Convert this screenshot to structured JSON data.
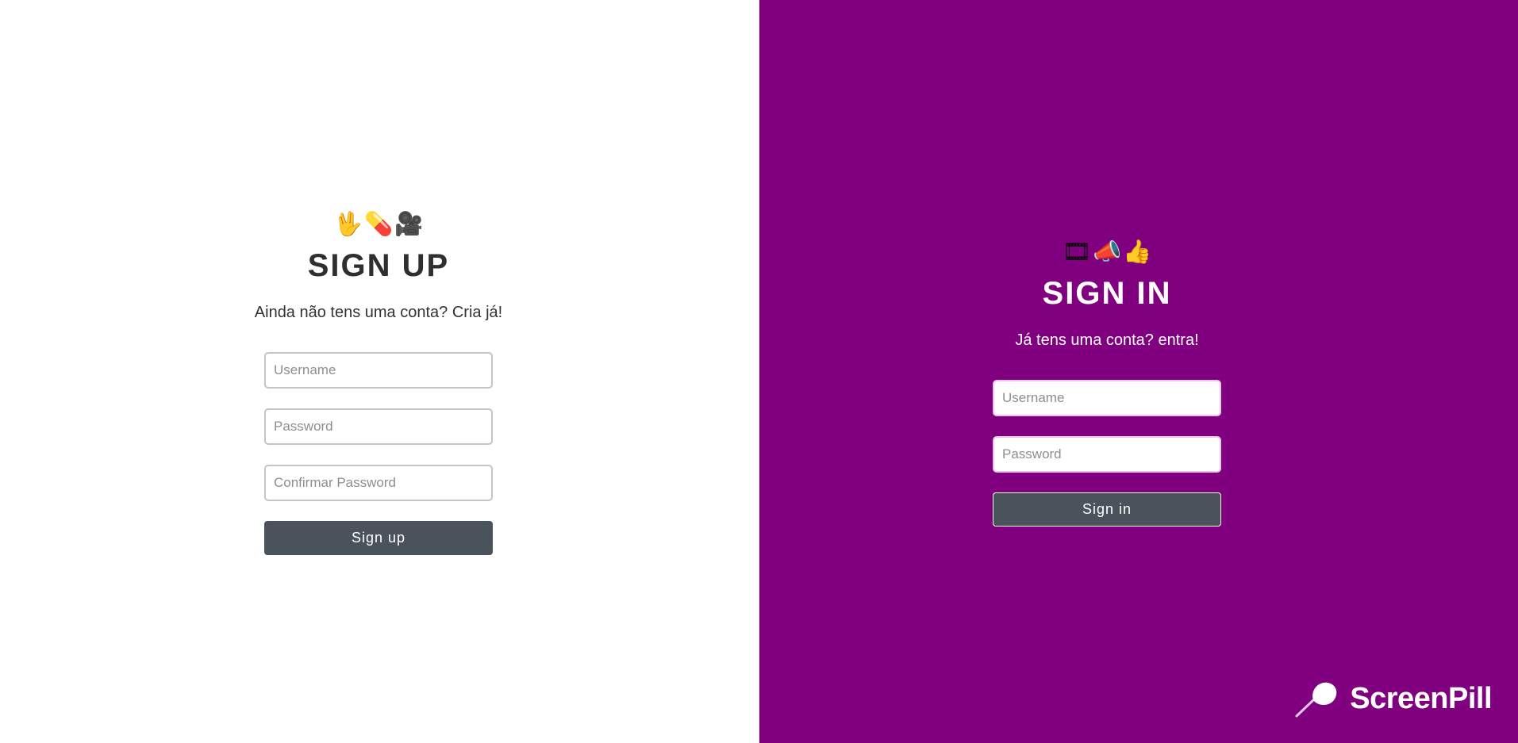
{
  "signup": {
    "emojis": [
      "🖖",
      "💊",
      "🎥"
    ],
    "title": "SIGN UP",
    "subtitle": "Ainda não tens uma conta? Cria já!",
    "username_placeholder": "Username",
    "password_placeholder": "Password",
    "confirm_password_placeholder": "Confirmar Password",
    "button_label": "Sign up"
  },
  "signin": {
    "emojis": [
      "🎞",
      "📣",
      "👍"
    ],
    "title": "SIGN IN",
    "subtitle": "Já tens uma conta? entra!",
    "username_placeholder": "Username",
    "password_placeholder": "Password",
    "button_label": "Sign in"
  },
  "branding": {
    "logo_text": "ScreenPill",
    "logo_icon": "pill-pin-icon"
  },
  "colors": {
    "left_background": "#ffffff",
    "right_background": "#800080",
    "button_background": "#4a525c",
    "heading_dark": "#2f2f2f"
  }
}
